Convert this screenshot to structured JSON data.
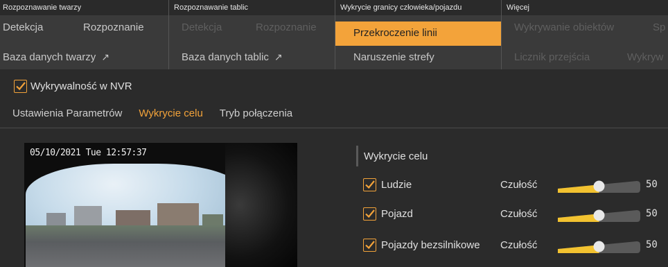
{
  "menu": {
    "group1": {
      "title": "Rozpoznawanie twarzy",
      "item1": "Detekcja",
      "item2": "Rozpoznanie",
      "item3": "Baza danych twarzy",
      "item3_icon": "external-link-icon"
    },
    "group2": {
      "title": "Rozpoznawanie tablic",
      "item1": "Detekcja",
      "item2": "Rozpoznanie",
      "item3": "Baza danych tablic",
      "item3_icon": "external-link-icon"
    },
    "group3": {
      "title": "Wykrycie granicy człowieka/pojazdu",
      "item1": "Przekroczenie linii",
      "item2": "Naruszenie strefy"
    },
    "group4": {
      "title": "Więcej",
      "item1": "Wykrywanie obiektów",
      "item2": "Sp",
      "item3": "Licznik przejścia",
      "item4": "Wykryw"
    }
  },
  "nvr_checkbox": {
    "label": "Wykrywalność w NVR",
    "checked": true
  },
  "tabs": [
    {
      "label": "Ustawienia Parametrów",
      "active": false
    },
    {
      "label": "Wykrycie celu",
      "active": true
    },
    {
      "label": "Tryb połączenia",
      "active": false
    }
  ],
  "video": {
    "timestamp": "05/10/2021 Tue 12:57:37"
  },
  "target_panel": {
    "title": "Wykrycie celu",
    "sensitivity_label": "Czułość",
    "rows": [
      {
        "label": "Ludzie",
        "checked": true,
        "value": "50",
        "level": 0.5
      },
      {
        "label": "Pojazd",
        "checked": true,
        "value": "50",
        "level": 0.5
      },
      {
        "label": "Pojazdy bezsilnikowe",
        "checked": true,
        "value": "50",
        "level": 0.5
      }
    ]
  },
  "colors": {
    "accent": "#f3a33a",
    "slider_fill": "#f2c230",
    "slider_track": "#5a5a5a",
    "background": "#2b2b2b",
    "menu_bg": "#3a3a3a"
  }
}
